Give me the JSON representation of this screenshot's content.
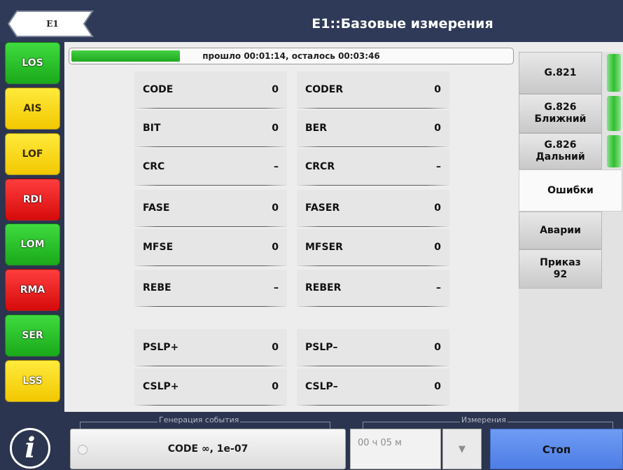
{
  "header": {
    "back_label": "E1",
    "title": "E1::Базовые измерения"
  },
  "alarms": [
    {
      "label": "LOS",
      "color": "green"
    },
    {
      "label": "AIS",
      "color": "yellow"
    },
    {
      "label": "LOF",
      "color": "yellow"
    },
    {
      "label": "RDI",
      "color": "red"
    },
    {
      "label": "LOM",
      "color": "green"
    },
    {
      "label": "RMA",
      "color": "red"
    },
    {
      "label": "SER",
      "color": "green"
    },
    {
      "label": "LSS",
      "color": "yellow"
    }
  ],
  "progress": {
    "text": "прошло 00:01:14, осталось 00:03:46",
    "fraction": 0.247
  },
  "metrics": {
    "left": [
      {
        "name": "CODE",
        "value": "0"
      },
      {
        "name": "BIT",
        "value": "0"
      },
      {
        "name": "CRC",
        "value": "–"
      },
      {
        "name": "FASE",
        "value": "0"
      },
      {
        "name": "MFSE",
        "value": "0"
      },
      {
        "name": "REBE",
        "value": "–"
      },
      {
        "name": "PSLP+",
        "value": "0"
      },
      {
        "name": "CSLP+",
        "value": "0"
      }
    ],
    "right": [
      {
        "name": "CODER",
        "value": "0"
      },
      {
        "name": "BER",
        "value": "0"
      },
      {
        "name": "CRCR",
        "value": "–"
      },
      {
        "name": "FASER",
        "value": "0"
      },
      {
        "name": "MFSER",
        "value": "0"
      },
      {
        "name": "REBER",
        "value": "–"
      },
      {
        "name": "PSLP–",
        "value": "0"
      },
      {
        "name": "CSLP–",
        "value": "0"
      }
    ]
  },
  "tabs": [
    {
      "label": "G.821",
      "indicator": true
    },
    {
      "label": "G.826\nБлижний",
      "indicator": true
    },
    {
      "label": "G.826\nДальний",
      "indicator": true
    },
    {
      "label": "Ошибки",
      "active": true
    },
    {
      "label": "Аварии"
    },
    {
      "label": "Приказ\n92"
    }
  ],
  "bottom": {
    "gen_group_label": "Генерация события",
    "gen_button_label": "CODE  ∞, 1e-07",
    "meas_group_label": "Измерения",
    "duration_value": "00 ч 05 м",
    "dropdown_icon": "▼",
    "stop_label": "Стоп"
  },
  "info_icon": "i",
  "colors": {
    "alarm_green": "#22b522",
    "alarm_yellow": "#f5d200",
    "alarm_red": "#e01414",
    "progress_green": "#2bbd2b",
    "stop_blue": "#5a87ea",
    "header_bg": "#2f3a59"
  }
}
